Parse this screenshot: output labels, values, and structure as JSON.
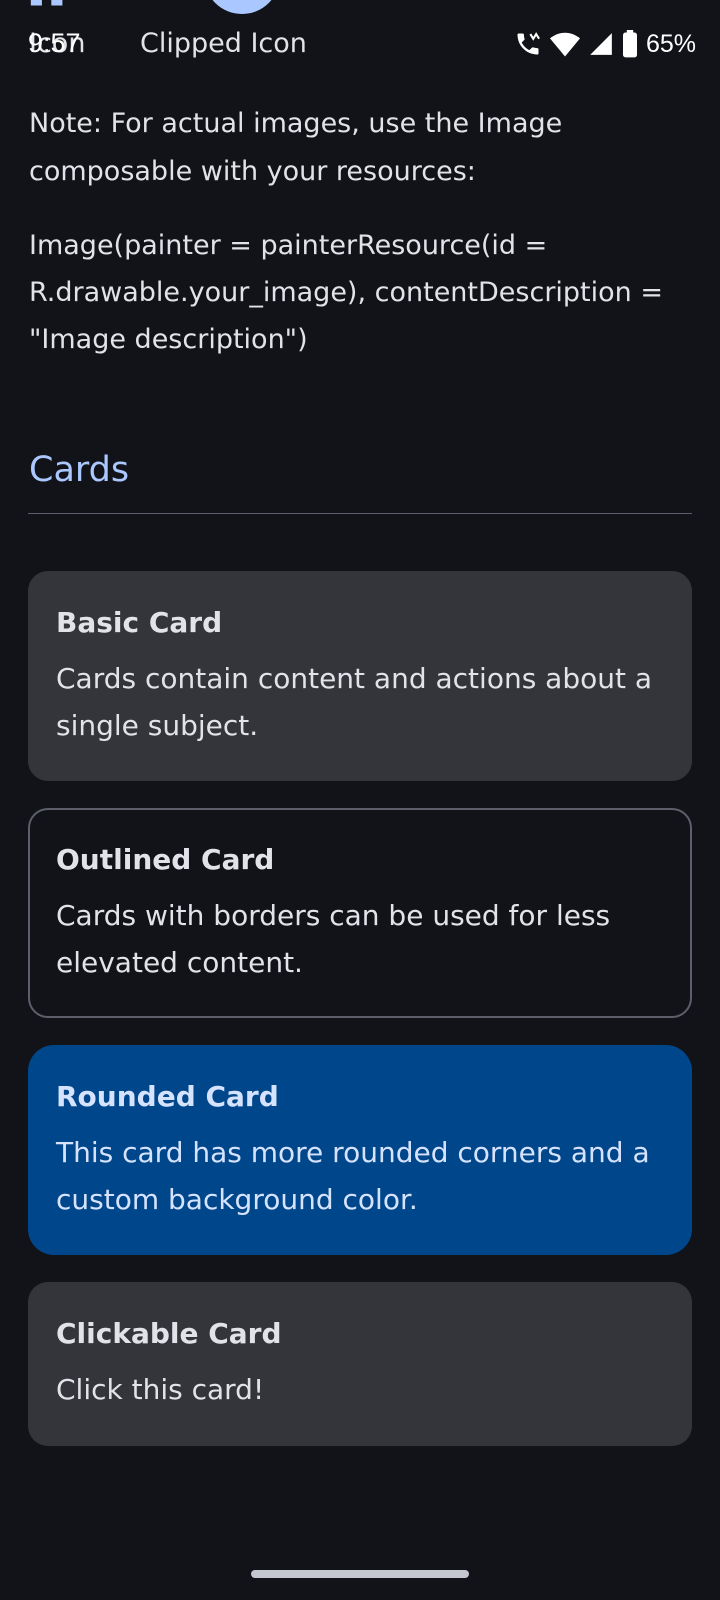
{
  "status_bar": {
    "time": "9:57",
    "battery": "65%"
  },
  "clipped_row": {
    "left_label": "Icon",
    "right_label": "Clipped Icon"
  },
  "note": {
    "text": "Note: For actual images, use the Image composable with your resources:",
    "code": "Image(painter = painterResource(id = R.drawable.your_image), contentDescription = \"Image description\")"
  },
  "section": {
    "title": "Cards"
  },
  "cards": [
    {
      "title": "Basic Card",
      "body": "Cards contain content and actions about a single subject."
    },
    {
      "title": "Outlined Card",
      "body": "Cards with borders can be used for less elevated content."
    },
    {
      "title": "Rounded Card",
      "body": "This card has more rounded corners and a custom background color."
    },
    {
      "title": "Clickable Card",
      "body": "Click this card!"
    }
  ],
  "colors": {
    "background": "#121318",
    "accent": "#aac7ff",
    "card_surface": "#33353a",
    "rounded_card": "#00468a",
    "outline": "#5c5f6a"
  }
}
